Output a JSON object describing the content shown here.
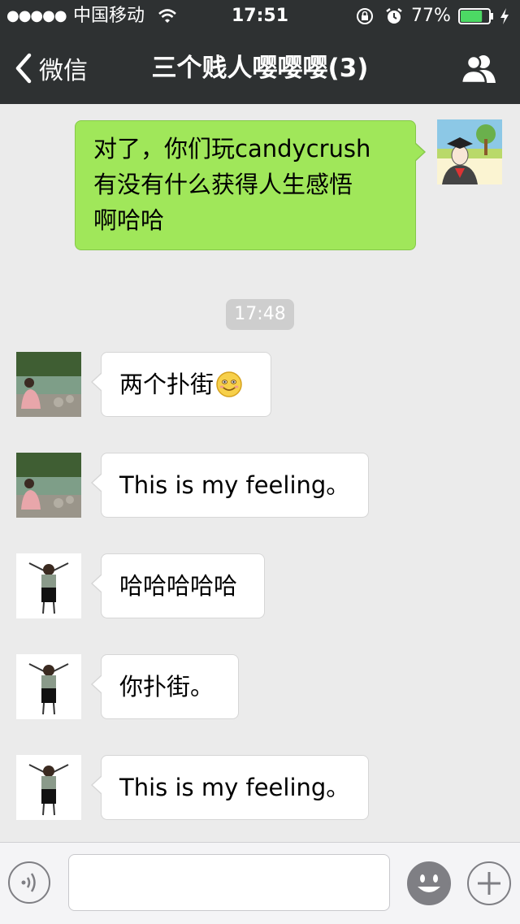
{
  "status_bar": {
    "signal": "●●●●●",
    "carrier": "中国移动",
    "time": "17:51",
    "battery_percent": "77%",
    "battery_level": 0.77,
    "icons": [
      "signal-dots-icon",
      "wifi-icon",
      "orientation-lock-icon",
      "alarm-icon",
      "battery-icon",
      "charging-bolt-icon"
    ]
  },
  "nav": {
    "back_label": "微信",
    "title": "三个贱人嘤嘤嘤(3)",
    "icons": [
      "chevron-left-icon",
      "group-members-icon"
    ]
  },
  "messages": [
    {
      "direction": "out",
      "lines": [
        "对了，你们玩candycrush",
        "有没有什么获得人生感悟",
        "啊哈哈"
      ],
      "avatar": "graduate-drawing-avatar"
    },
    {
      "direction": "in",
      "text": "两个扑街",
      "emoji": "smiley-emoji",
      "avatar": "girl-riverside-photo-avatar"
    },
    {
      "direction": "in",
      "text": "This is my feeling。",
      "avatar": "girl-riverside-photo-avatar"
    },
    {
      "direction": "in",
      "text": "哈哈哈哈哈",
      "avatar": "cartoon-girl-avatar"
    },
    {
      "direction": "in",
      "text": "你扑街。",
      "avatar": "cartoon-girl-avatar"
    },
    {
      "direction": "in",
      "text": "This is my feeling。",
      "avatar": "cartoon-girl-avatar"
    }
  ],
  "timestamp": "17:48",
  "input_bar": {
    "text_value": "",
    "icons": [
      "voice-icon",
      "emoji-icon",
      "plus-icon"
    ]
  },
  "colors": {
    "header_bg": "#2e3132",
    "chat_bg": "#ebebeb",
    "out_bubble": "#a0e75a",
    "in_bubble": "#ffffff",
    "battery_fill": "#4cd964"
  }
}
